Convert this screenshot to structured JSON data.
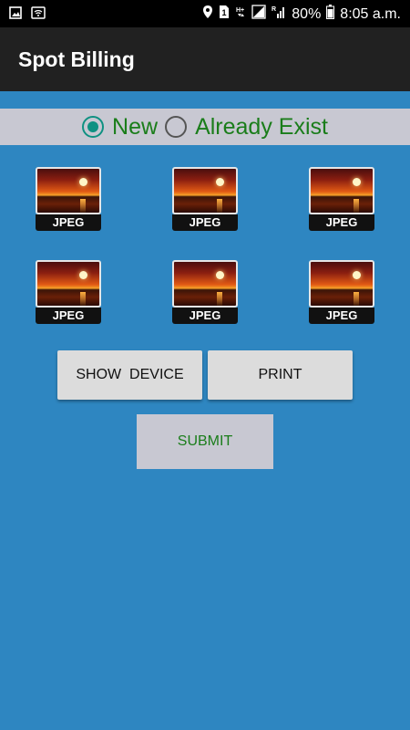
{
  "status_bar": {
    "battery": "80%",
    "time": "8:05 a.m.",
    "sim_slot": "1",
    "network_left": "H+",
    "network_right": "R"
  },
  "app_bar": {
    "title": "Spot Billing"
  },
  "customer_type": {
    "options": [
      {
        "label": "New",
        "selected": true
      },
      {
        "label": "Already Exist",
        "selected": false
      }
    ]
  },
  "images": [
    {
      "label": "JPEG"
    },
    {
      "label": "JPEG"
    },
    {
      "label": "JPEG"
    },
    {
      "label": "JPEG"
    },
    {
      "label": "JPEG"
    },
    {
      "label": "JPEG"
    }
  ],
  "buttons": {
    "show_device": "SHOW  DEVICE",
    "print": "PRINT",
    "submit": "SUBMIT"
  },
  "colors": {
    "background": "#2e86c1",
    "app_bar": "#212121",
    "radio_accent": "#0f9182",
    "green_text": "#1a7d1a"
  }
}
